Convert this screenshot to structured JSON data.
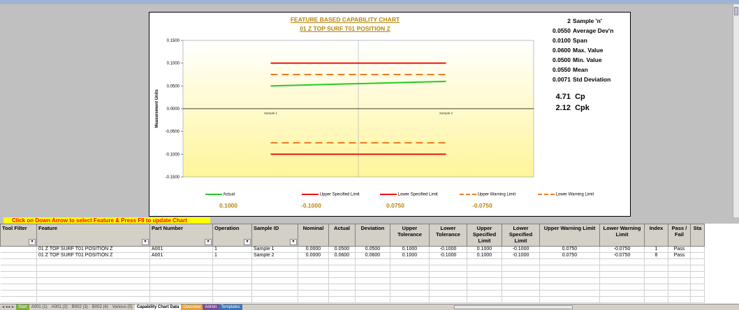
{
  "chart": {
    "title_line1": "FEATURE BASED CAPABILITY CHART",
    "title_line2": "01 Z TOP SURF T01 POSITION Z",
    "colors": {
      "actual": "#22cc22",
      "spec": "#ee1111",
      "warning": "#f07a22",
      "title": "#b8860b"
    }
  },
  "stats": [
    {
      "value": "2",
      "label": "Sample 'n'"
    },
    {
      "value": "0.0550",
      "label": "Average Dev'n"
    },
    {
      "value": "0.0100",
      "label": "Span"
    },
    {
      "value": "0.0600",
      "label": "Max. Value"
    },
    {
      "value": "0.0500",
      "label": "Min. Value"
    },
    {
      "value": "0.0550",
      "label": "Mean"
    },
    {
      "value": "0.0071",
      "label": "Std Deviation"
    }
  ],
  "capability": [
    {
      "value": "4.71",
      "label": "Cp"
    },
    {
      "value": "2.12",
      "label": "Cpk"
    }
  ],
  "chart_data": {
    "type": "line",
    "title": "FEATURE BASED CAPABILITY CHART",
    "subtitle": "01 Z TOP SURF T01 POSITION Z",
    "ylabel": "Measurement Units",
    "xlabel": "",
    "categories": [
      "Sample 1",
      "Sample 2"
    ],
    "ylim": [
      -0.15,
      0.15
    ],
    "yticks": [
      "0.1500",
      "0.1000",
      "0.0500",
      "0.0000",
      "-0.0500",
      "-0.1000",
      "-0.1500"
    ],
    "grid": true,
    "legend_position": "bottom",
    "series": [
      {
        "name": "Actual",
        "values": [
          0.05,
          0.06
        ],
        "style": "solid",
        "color": "#22cc22"
      },
      {
        "name": "Upper Specified Limit",
        "values": [
          0.1,
          0.1
        ],
        "style": "solid",
        "color": "#ee1111"
      },
      {
        "name": "Lower Specified Limit",
        "values": [
          -0.1,
          -0.1
        ],
        "style": "solid",
        "color": "#ee1111"
      },
      {
        "name": "Upper Warning Limit",
        "values": [
          0.075,
          0.075
        ],
        "style": "dashed",
        "color": "#f07a22"
      },
      {
        "name": "Lower Warning Limit",
        "values": [
          -0.075,
          -0.075
        ],
        "style": "dashed",
        "color": "#f07a22"
      }
    ],
    "limit_values": [
      "0.1000",
      "-0.1000",
      "0.0750",
      "-0.0750"
    ]
  },
  "notice": "Click on Down Arrow to select Feature & Press F9 to update Chart",
  "table": {
    "headers": [
      "Tool Filter",
      "Feature",
      "Part Number",
      "Operation",
      "Sample ID",
      "Nominal",
      "Actual",
      "Deviation",
      "Upper Tolerance",
      "Lower Tolerance",
      "Upper Specified Limit",
      "Lower Specified Limit",
      "Upper Warning Limit",
      "Lower Warning Limit",
      "Index",
      "Pass / Fail",
      "Sta"
    ],
    "rows": [
      [
        "",
        "01 Z TOP SURF T01 POSITION Z",
        "A001",
        "1",
        "Sample 1",
        "0.0000",
        "0.0500",
        "0.0500",
        "0.1000",
        "-0.1000",
        "0.1000",
        "-0.1000",
        "0.0750",
        "-0.0750",
        "1",
        "Pass",
        ""
      ],
      [
        "",
        "01 Z TOP SURF T01 POSITION Z",
        "A001",
        "1",
        "Sample 2",
        "0.0000",
        "0.0600",
        "0.0600",
        "0.1000",
        "-0.1000",
        "0.1000",
        "-0.1000",
        "0.0750",
        "-0.0750",
        "8",
        "Pass",
        ""
      ]
    ],
    "empty_rows": 7
  },
  "tabs": [
    {
      "label": "Start",
      "style": "green"
    },
    {
      "label": "A001 (1)",
      "style": ""
    },
    {
      "label": "A001 (2)",
      "style": ""
    },
    {
      "label": "B002 (3)",
      "style": ""
    },
    {
      "label": "B002 (4)",
      "style": ""
    },
    {
      "label": "Various (5)",
      "style": ""
    },
    {
      "label": "Capability Chart Data",
      "style": "active"
    },
    {
      "label": "Overview",
      "style": "orange"
    },
    {
      "label": "Admin",
      "style": "purple"
    },
    {
      "label": "Templates",
      "style": "blue"
    }
  ]
}
